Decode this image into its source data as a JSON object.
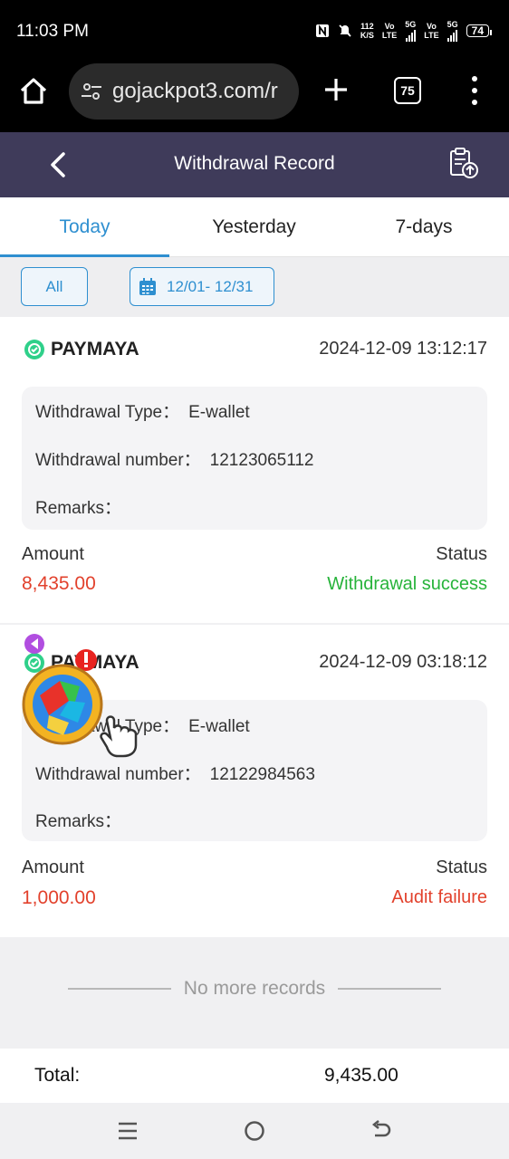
{
  "status_bar": {
    "time": "11:03 PM",
    "net_speed_top": "112",
    "net_speed_bottom": "K/S",
    "sim1_top": "Vo",
    "sim1_bottom": "LTE",
    "sim1_gen": "5G",
    "sim2_top": "Vo",
    "sim2_bottom": "LTE",
    "sim2_gen": "5G",
    "battery": "74"
  },
  "browser": {
    "url": "gojackpot3.com/r",
    "tab_count": "75"
  },
  "header": {
    "title": "Withdrawal Record"
  },
  "tabs": [
    {
      "label": "Today",
      "active": true
    },
    {
      "label": "Yesterday",
      "active": false
    },
    {
      "label": "7-days",
      "active": false
    }
  ],
  "filters": {
    "all_label": "All",
    "date_range": "12/01- 12/31"
  },
  "records": [
    {
      "provider": "PAYMAYA",
      "datetime": "2024-12-09 13:12:17",
      "type_label": "Withdrawal Type：",
      "type_value": "E-wallet",
      "number_label": "Withdrawal number：",
      "number_value": "12123065112",
      "remarks_label": "Remarks：",
      "amount_label": "Amount",
      "status_label": "Status",
      "amount": "8,435.00",
      "status": "Withdrawal success",
      "status_color": "#27b33a"
    },
    {
      "provider": "PAYMAYA",
      "datetime": "2024-12-09 03:18:12",
      "type_label": "Withdrawal Type：",
      "type_value": "E-wallet",
      "number_label": "Withdrawal number：",
      "number_value": "12122984563",
      "remarks_label": "Remarks：",
      "amount_label": "Amount",
      "status_label": "Status",
      "amount": "1,000.00",
      "status": "Audit failure",
      "status_color": "#e2412c"
    }
  ],
  "no_more": "No more records",
  "total": {
    "label": "Total:",
    "value": "9,435.00"
  },
  "colors": {
    "header_bg": "#3f3b5a",
    "accent": "#2e8fd0",
    "amount_red": "#e2412c",
    "success_green": "#27b33a"
  }
}
